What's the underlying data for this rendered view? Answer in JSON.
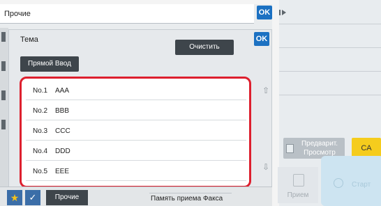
{
  "outer_dialog": {
    "title": "Прочие",
    "ok_label": "OK"
  },
  "inner_dialog": {
    "title": "Тема",
    "ok_label": "OK",
    "clear_label": "Очистить",
    "direct_input_label": "Прямой Ввод",
    "scroll_up_icon": "double-chevron-up-icon",
    "scroll_down_icon": "double-chevron-down-icon"
  },
  "subject_list": [
    {
      "number": "No.1",
      "name": "AAA"
    },
    {
      "number": "No.2",
      "name": "BBB"
    },
    {
      "number": "No.3",
      "name": "CCC"
    },
    {
      "number": "No.4",
      "name": "DDD"
    },
    {
      "number": "No.5",
      "name": "EEE"
    }
  ],
  "right_panel": {
    "preview_label": "Предварит. Просмотр",
    "ca_label": "CA",
    "receive_label": "Прием",
    "start_label": "Старт"
  },
  "bottom_bar": {
    "misc_label": "Прочие",
    "fax_memory_label": "Память приема Факса"
  },
  "colors": {
    "ok_blue": "#1c71c2",
    "highlight_red": "#dd1f2e",
    "ca_yellow": "#f5cc1d",
    "dark_button": "#3e454b"
  }
}
